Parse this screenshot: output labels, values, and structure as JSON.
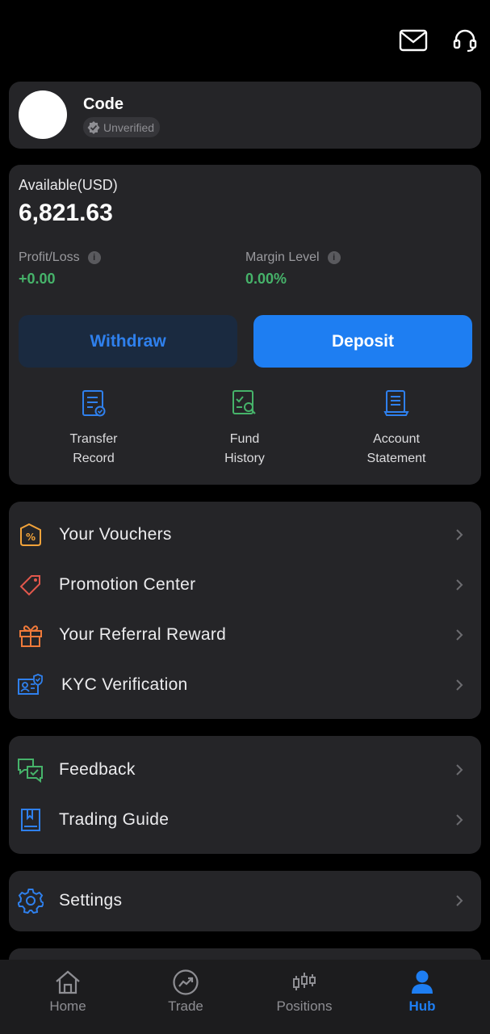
{
  "header": {
    "mail_icon": "mail-icon",
    "support_icon": "headset-icon"
  },
  "profile": {
    "name": "Code",
    "status": "Unverified"
  },
  "account": {
    "available_label": "Available(USD)",
    "available_value": "6,821.63",
    "profit_label": "Profit/Loss",
    "profit_value": "+0.00",
    "margin_label": "Margin Level",
    "margin_value": "0.00%",
    "withdraw_label": "Withdraw",
    "deposit_label": "Deposit",
    "quick_links": [
      {
        "label": "Transfer\nRecord",
        "icon": "transfer-record-icon"
      },
      {
        "label": "Fund\nHistory",
        "icon": "fund-history-icon"
      },
      {
        "label": "Account\nStatement",
        "icon": "account-statement-icon"
      }
    ]
  },
  "menu_primary": [
    {
      "label": "Your Vouchers",
      "icon": "voucher-icon"
    },
    {
      "label": "Promotion Center",
      "icon": "tag-icon"
    },
    {
      "label": "Your Referral Reward",
      "icon": "gift-icon"
    },
    {
      "label": "KYC Verification",
      "icon": "id-verify-icon"
    }
  ],
  "menu_secondary": [
    {
      "label": "Feedback",
      "icon": "chat-bubbles-icon"
    },
    {
      "label": "Trading Guide",
      "icon": "book-icon"
    }
  ],
  "menu_settings": [
    {
      "label": "Settings",
      "icon": "gear-icon"
    }
  ],
  "tabs": [
    {
      "label": "Home",
      "icon": "home-icon",
      "active": false
    },
    {
      "label": "Trade",
      "icon": "trend-icon",
      "active": false
    },
    {
      "label": "Positions",
      "icon": "candlestick-icon",
      "active": false
    },
    {
      "label": "Hub",
      "icon": "user-icon",
      "active": true
    }
  ],
  "colors": {
    "accent": "#1e7ef2",
    "positive": "#46b36a",
    "card": "#252528",
    "background": "#000000"
  }
}
